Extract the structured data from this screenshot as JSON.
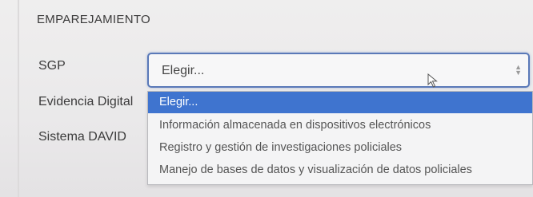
{
  "section": {
    "title": "EMPAREJAMIENTO"
  },
  "fields": {
    "sgp_label": "SGP",
    "evidencia_label": "Evidencia Digital",
    "david_label": "Sistema DAVID"
  },
  "select": {
    "value": "Elegir...",
    "options": [
      {
        "label": "Elegir...",
        "selected": true
      },
      {
        "label": "Información almacenada en dispositivos electrónicos",
        "selected": false
      },
      {
        "label": "Registro y gestión de investigaciones policiales",
        "selected": false
      },
      {
        "label": "Manejo de bases de datos y visualización de datos policiales",
        "selected": false
      }
    ]
  },
  "colors": {
    "selected_option_bg": "#3f74cf",
    "focus_border": "#5a79b8"
  },
  "icons": {
    "select_arrows": "up-down-arrows-icon",
    "pointer": "mouse-pointer-icon"
  }
}
